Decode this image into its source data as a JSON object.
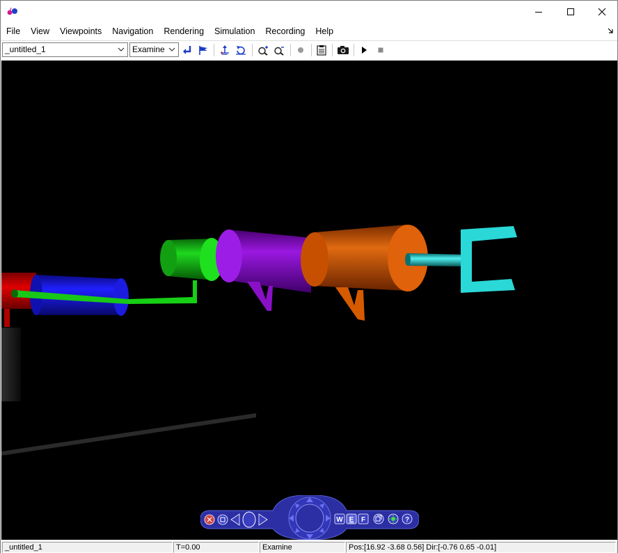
{
  "window": {
    "close_glyph": "✕",
    "maximize_glyph": "☐",
    "minimize_glyph": "—"
  },
  "menu": {
    "items": [
      {
        "label": "File"
      },
      {
        "label": "View"
      },
      {
        "label": "Viewpoints"
      },
      {
        "label": "Navigation"
      },
      {
        "label": "Rendering"
      },
      {
        "label": "Simulation"
      },
      {
        "label": "Recording"
      },
      {
        "label": "Help"
      }
    ]
  },
  "toolbar": {
    "world_combo_value": "_untitled_1",
    "navigation_combo_value": "Examine",
    "buttons": [
      {
        "name": "return-to-viewpoint-icon"
      },
      {
        "name": "flag-viewpoint-icon"
      },
      {
        "name": "straighten-up-icon"
      },
      {
        "name": "rotate-view-icon"
      },
      {
        "name": "zoom-in-icon"
      },
      {
        "name": "zoom-out-icon"
      },
      {
        "name": "record-indicator-icon"
      },
      {
        "name": "properties-icon"
      },
      {
        "name": "snapshot-camera-icon"
      },
      {
        "name": "play-icon"
      },
      {
        "name": "stop-icon"
      }
    ]
  },
  "navpanel": {
    "walk_label": "W",
    "examine_label": "E",
    "fly_label": "F",
    "help_label": "?"
  },
  "status": {
    "world": "_untitled_1",
    "time": "T=0.00",
    "mode": "Examine",
    "position": "Pos:[16.92 -3.68 0.56] Dir:[-0.76 0.65 -0.01]"
  },
  "colors": {
    "viewport_bg": "#000000",
    "navpanel": "#2b2fa3",
    "toolbar_icon": "#1a3cc8",
    "red_part": "#d40000",
    "blue_part": "#1515d8",
    "green_part": "#12c812",
    "purple_part": "#8a10c8",
    "orange_part": "#d65a00",
    "cyan_part": "#2ad8d8"
  }
}
